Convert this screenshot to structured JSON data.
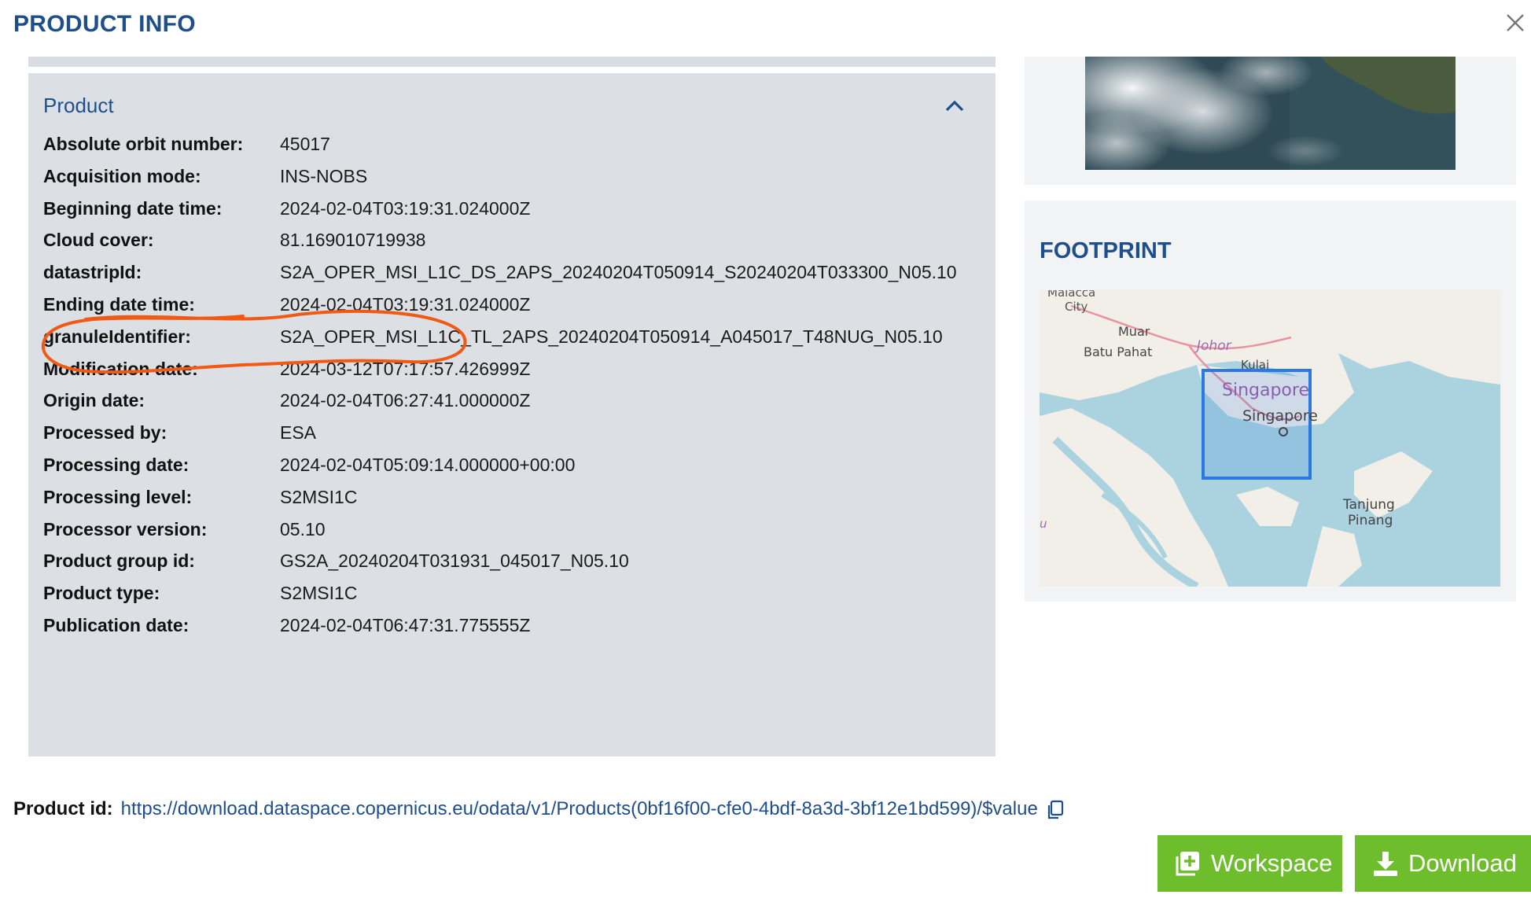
{
  "dialog": {
    "title": "PRODUCT INFO"
  },
  "product_section": {
    "title": "Product",
    "attributes": [
      {
        "label": "Absolute orbit number:",
        "value": "45017"
      },
      {
        "label": "Acquisition mode:",
        "value": "INS-NOBS"
      },
      {
        "label": "Beginning date time:",
        "value": "2024-02-04T03:19:31.024000Z"
      },
      {
        "label": "Cloud cover:",
        "value": "81.169010719938"
      },
      {
        "label": "datastripId:",
        "value": "S2A_OPER_MSI_L1C_DS_2APS_20240204T050914_S20240204T033300_N05.10"
      },
      {
        "label": "Ending date time:",
        "value": "2024-02-04T03:19:31.024000Z"
      },
      {
        "label": "granuleIdentifier:",
        "value": "S2A_OPER_MSI_L1C_TL_2APS_20240204T050914_A045017_T48NUG_N05.10"
      },
      {
        "label": "Modification date:",
        "value": "2024-03-12T07:17:57.426999Z"
      },
      {
        "label": "Origin date:",
        "value": "2024-02-04T06:27:41.000000Z"
      },
      {
        "label": "Processed by:",
        "value": "ESA"
      },
      {
        "label": "Processing date:",
        "value": "2024-02-04T05:09:14.000000+00:00"
      },
      {
        "label": "Processing level:",
        "value": "S2MSI1C"
      },
      {
        "label": "Processor version:",
        "value": "05.10"
      },
      {
        "label": "Product group id:",
        "value": "GS2A_20240204T031931_045017_N05.10"
      },
      {
        "label": "Product type:",
        "value": "S2MSI1C"
      },
      {
        "label": "Publication date:",
        "value": "2024-02-04T06:47:31.775555Z"
      }
    ]
  },
  "footprint": {
    "title": "FOOTPRINT",
    "map_labels": {
      "malacca": "Malacca",
      "city": "City",
      "muar": "Muar",
      "johor": "Johor",
      "batu_pahat": "Batu Pahat",
      "kulai": "Kulai",
      "singapore_country": "Singapore",
      "singapore_city": "Singapore",
      "tanjung": "Tanjung",
      "pinang": "Pinang",
      "edge": "u"
    }
  },
  "product_id": {
    "label": "Product id:",
    "url": "https://download.dataspace.copernicus.eu/odata/v1/Products(0bf16f00-cfe0-4bdf-8a3d-3bf12e1bd599)/$value"
  },
  "buttons": {
    "workspace": "Workspace",
    "download": "Download"
  },
  "colors": {
    "title_blue": "#1f4e8c",
    "button_green": "#6ebd2c",
    "panel_gray": "#dcdfe3",
    "annotation_orange": "#f05a14",
    "footprint_blue": "#2a78e0"
  },
  "icons": {
    "close": "close-icon",
    "collapse": "chevron-up-icon",
    "copy": "copy-icon",
    "workspace": "add-to-workspace-icon",
    "download": "download-icon"
  }
}
